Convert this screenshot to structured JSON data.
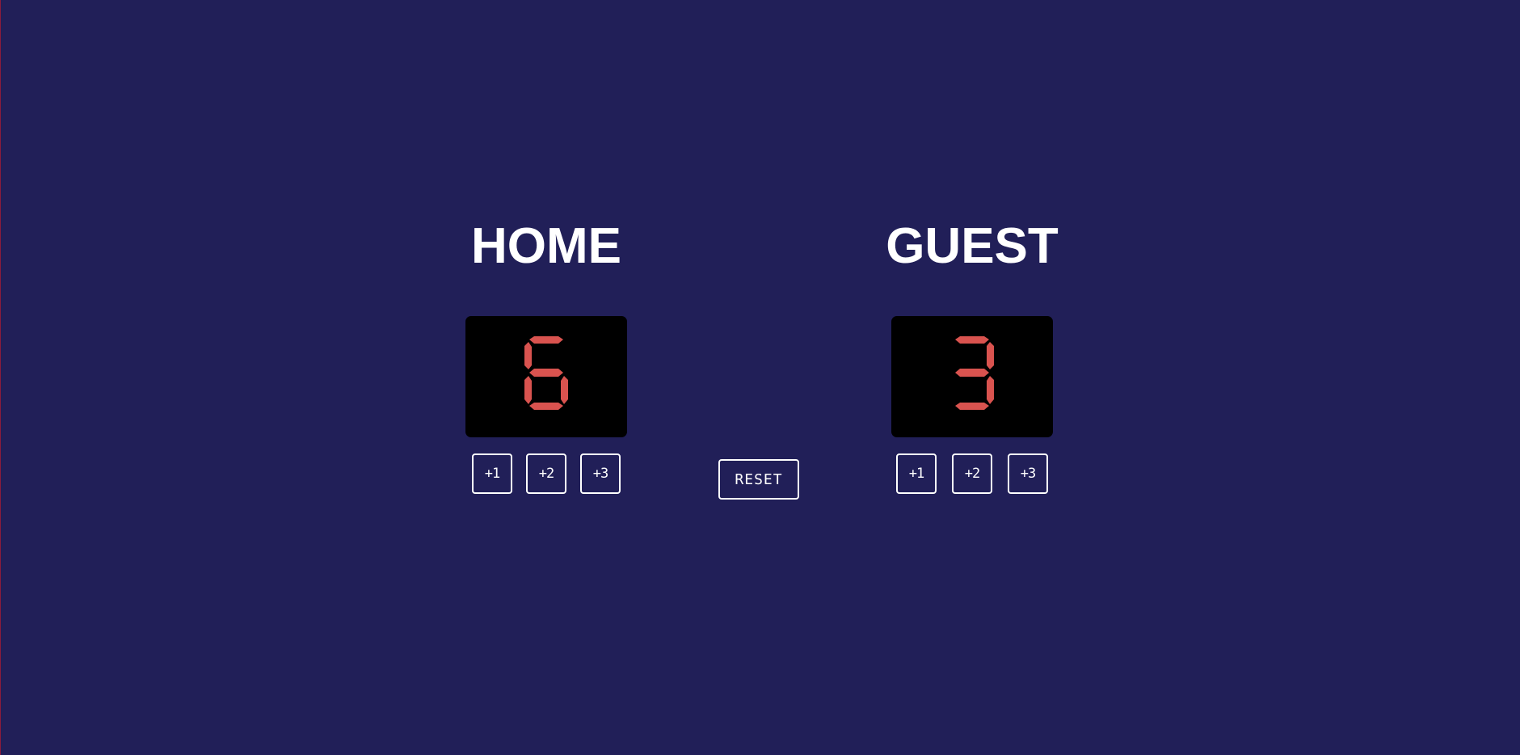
{
  "home": {
    "name": "HOME",
    "score": "6",
    "buttons": [
      "+1",
      "+2",
      "+3"
    ]
  },
  "guest": {
    "name": "GUEST",
    "score": "3",
    "buttons": [
      "+1",
      "+2",
      "+3"
    ]
  },
  "reset_label": "RESET",
  "colors": {
    "background": "#211f58",
    "score_digit": "#d9534f",
    "score_bg": "#000000",
    "text": "#ffffff"
  }
}
